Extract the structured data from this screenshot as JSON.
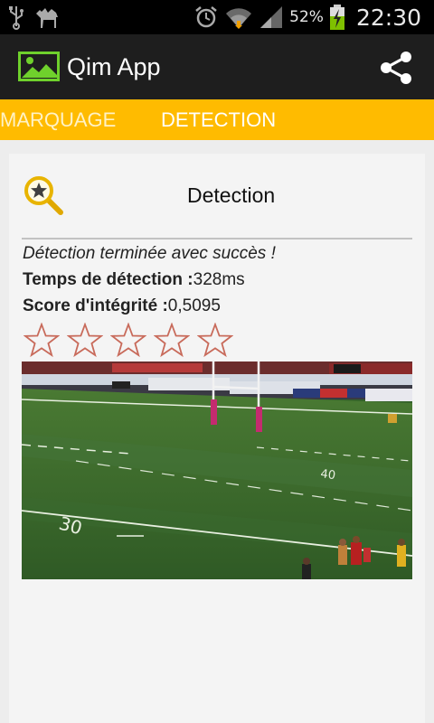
{
  "status_bar": {
    "time": "22:30",
    "battery_percent": "52%",
    "icons": [
      "usb-icon",
      "camel-icon",
      "alarm-icon",
      "wifi-icon",
      "signal-icon",
      "battery-charging-icon"
    ]
  },
  "action_bar": {
    "app_title": "Qim App",
    "share_icon": "share-icon"
  },
  "tabs": [
    {
      "label": "MARQUAGE",
      "selected": false
    },
    {
      "label": "DETECTION",
      "selected": true
    }
  ],
  "detection": {
    "title": "Detection",
    "status_message": "Détection terminée avec succès !",
    "time_label": "Temps de détection :",
    "time_value": "328ms",
    "score_label": "Score d'intégrité :",
    "score_value": "0,5095",
    "rating": {
      "filled": 0,
      "max": 5
    }
  },
  "colors": {
    "tab_bar": "#ffbb00",
    "action_bar": "#1e1e1e",
    "status_bar": "#000000",
    "star_outline": "#c86a5a",
    "app_icon": "#6fd12c"
  }
}
